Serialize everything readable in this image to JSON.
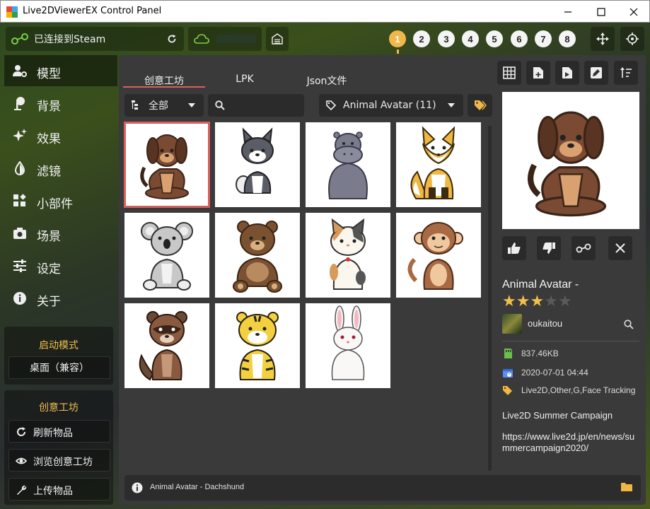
{
  "window": {
    "title": "Live2DViewerEX Control Panel",
    "minimize_icon": "minimize-icon",
    "maximize_icon": "maximize-icon",
    "close_icon": "close-icon"
  },
  "topbar": {
    "steam_status": "已连接到Steam",
    "slots": [
      "1",
      "2",
      "3",
      "4",
      "5",
      "6",
      "7",
      "8"
    ],
    "active_slot": "1"
  },
  "sidebar": {
    "items": [
      {
        "label": "模型",
        "icon": "user-gear-icon",
        "active": true
      },
      {
        "label": "背景",
        "icon": "tree-icon"
      },
      {
        "label": "效果",
        "icon": "sparkle-icon"
      },
      {
        "label": "滤镜",
        "icon": "droplet-icon"
      },
      {
        "label": "小部件",
        "icon": "widgets-icon"
      },
      {
        "label": "场景",
        "icon": "camera-icon"
      },
      {
        "label": "设定",
        "icon": "sliders-icon"
      },
      {
        "label": "关于",
        "icon": "info-icon"
      }
    ],
    "launch_mode": {
      "title": "启动模式",
      "button": "桌面（兼容）"
    },
    "workshop": {
      "title": "创意工坊",
      "buttons": [
        {
          "label": "刷新物品",
          "icon": "refresh-icon"
        },
        {
          "label": "浏览创意工坊",
          "icon": "eye-icon"
        },
        {
          "label": "上传物品",
          "icon": "wrench-icon"
        }
      ]
    }
  },
  "tabs": [
    "创意工坊",
    "LPK",
    "Json文件"
  ],
  "filters": {
    "category": "全部",
    "search_placeholder": "",
    "tag": "Animal Avatar (11)"
  },
  "grid": {
    "items": [
      {
        "name": "dachshund",
        "selected": true
      },
      {
        "name": "husky"
      },
      {
        "name": "hippo"
      },
      {
        "name": "fox"
      },
      {
        "name": "koala"
      },
      {
        "name": "bear"
      },
      {
        "name": "cat"
      },
      {
        "name": "monkey"
      },
      {
        "name": "raccoon"
      },
      {
        "name": "tiger"
      },
      {
        "name": "rabbit"
      }
    ]
  },
  "status": {
    "text": "Animal Avatar - Dachshund"
  },
  "detail": {
    "title": "Animal Avatar -",
    "rating": 3,
    "rating_max": 5,
    "author": "oukaitou",
    "size": "837.46KB",
    "date": "2020-07-01 04:44",
    "tags": "Live2D,Other,G,Face Tracking",
    "desc1": "Live2D Summer Campaign",
    "desc2": "https://www.live2d.jp/en/news/summercampaign2020/"
  },
  "colors": {
    "accent": "#d8605c",
    "highlight": "#f0b84a",
    "star_on": "#f2c04a",
    "star_off": "#5a5a5a"
  }
}
